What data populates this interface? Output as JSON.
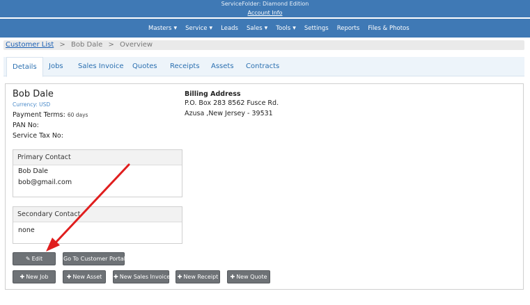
{
  "app": {
    "title": "ServiceFolder: Diamond Edition",
    "account_link": "Account Info"
  },
  "nav": {
    "items": [
      {
        "label": "Masters",
        "has_caret": true
      },
      {
        "label": "Service",
        "has_caret": true
      },
      {
        "label": "Leads",
        "has_caret": false
      },
      {
        "label": "Sales",
        "has_caret": true
      },
      {
        "label": "Tools",
        "has_caret": true
      },
      {
        "label": "Settings",
        "has_caret": false
      },
      {
        "label": "Reports",
        "has_caret": false
      },
      {
        "label": "Files & Photos",
        "has_caret": false
      }
    ],
    "caret_glyph": "▼"
  },
  "breadcrumb": {
    "root": "Customer List",
    "separator": ">",
    "customer": "Bob Dale",
    "page": "Overview"
  },
  "tabs": [
    {
      "label": "Details",
      "active": true
    },
    {
      "label": "Jobs",
      "active": false
    },
    {
      "label": "Sales Invoice",
      "active": false
    },
    {
      "label": "Quotes",
      "active": false
    },
    {
      "label": "Receipts",
      "active": false
    },
    {
      "label": "Assets",
      "active": false
    },
    {
      "label": "Contracts",
      "active": false
    }
  ],
  "customer": {
    "name": "Bob Dale",
    "currency": "Currency: USD",
    "payment_terms_label": "Payment Terms:",
    "payment_terms_value": "60 days",
    "pan_label": "PAN No:",
    "service_tax_label": "Service Tax No:"
  },
  "billing": {
    "title": "Billing Address",
    "line1": "P.O. Box 283 8562 Fusce Rd.",
    "line2": "Azusa ,New Jersey - 39531"
  },
  "primary_contact": {
    "title": "Primary Contact",
    "name": "Bob Dale",
    "email": "bob@gmail.com"
  },
  "secondary_contact": {
    "title": "Secondary Contact",
    "value": "none"
  },
  "buttons": {
    "edit": "Edit",
    "portal": "Go To Customer Portal",
    "new_job": "New Job",
    "new_asset": "New Asset",
    "new_sales_invoice": "New Sales Invoice",
    "new_receipt": "New Receipt",
    "new_quote": "New Quote"
  },
  "icons": {
    "edit_icon": "✎",
    "plus_icon": "✚"
  },
  "colors": {
    "header_blue": "#3f79b5",
    "button_gray": "#6e7276",
    "annotation_arrow": "#e01e1e",
    "link_blue": "#1a5fb4"
  }
}
